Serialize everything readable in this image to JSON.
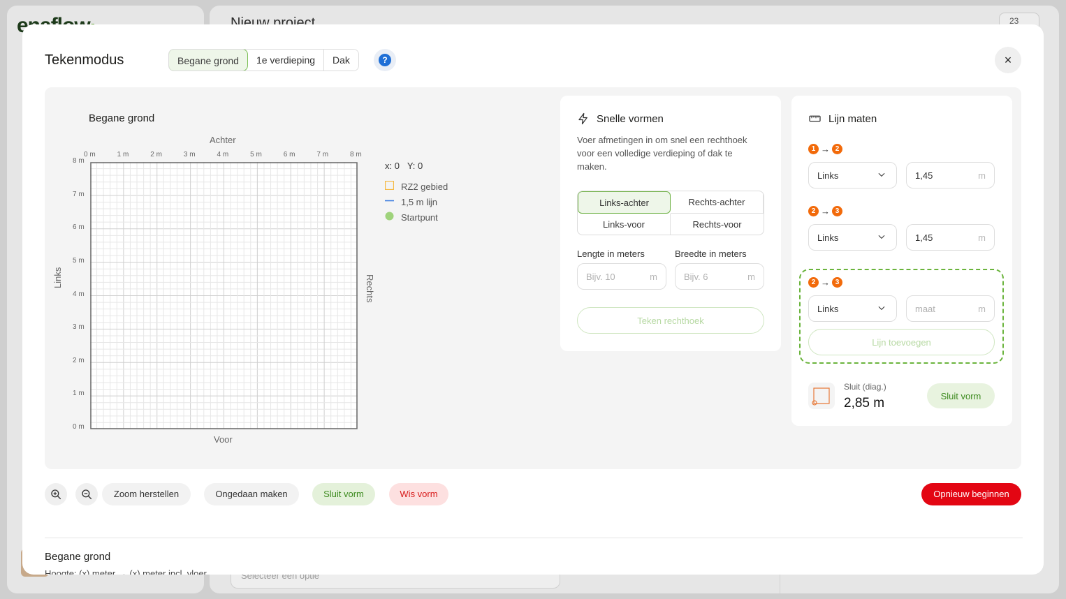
{
  "background": {
    "logo_main": "enaflow",
    "logo_dot": "·",
    "project_title": "Nieuw project",
    "badge_text": "23",
    "select_placeholder": "Selecteer een optie"
  },
  "modal": {
    "title": "Tekenmodus",
    "tabs": [
      {
        "label": "Begane grond",
        "active": true
      },
      {
        "label": "1e verdieping",
        "active": false
      },
      {
        "label": "Dak",
        "active": false
      }
    ],
    "help_label": "?",
    "close_label": "×"
  },
  "canvas": {
    "title": "Begane grond",
    "label_top": "Achter",
    "label_bottom": "Voor",
    "label_left": "Links",
    "label_right": "Rechts",
    "x_ticks": [
      "0 m",
      "1 m",
      "2 m",
      "3 m",
      "4 m",
      "5 m",
      "6 m",
      "7 m",
      "8 m"
    ],
    "y_ticks": [
      "8 m",
      "7 m",
      "6 m",
      "5 m",
      "4 m",
      "3 m",
      "2 m",
      "1 m",
      "0 m"
    ],
    "coords": {
      "x": "x: 0",
      "y": "Y: 0"
    },
    "legend": [
      {
        "label": "RZ2 gebied",
        "type": "square",
        "color": "#f5b942"
      },
      {
        "label": "1,5 m lijn",
        "type": "line",
        "color": "#3a7be0"
      },
      {
        "label": "Startpunt",
        "type": "dot",
        "color": "#9fd37c"
      }
    ]
  },
  "snelle_vormen": {
    "title": "Snelle vormen",
    "description": "Voer afmetingen in om snel een rechthoek voor een volledige verdieping of dak te maken.",
    "options": [
      {
        "label": "Links-achter",
        "selected": true
      },
      {
        "label": "Rechts-achter",
        "selected": false
      },
      {
        "label": "Links-voor",
        "selected": false
      },
      {
        "label": "Rechts-voor",
        "selected": false
      }
    ],
    "length_label": "Lengte in meters",
    "width_label": "Breedte in meters",
    "length_placeholder": "Bijv. 10",
    "width_placeholder": "Bijv. 6",
    "unit": "m",
    "draw_button": "Teken rechthoek"
  },
  "lijn_maten": {
    "title": "Lijn maten",
    "rows": [
      {
        "from": "1",
        "to": "2",
        "direction": "Links",
        "value": "1,45",
        "unit": "m"
      },
      {
        "from": "2",
        "to": "3",
        "direction": "Links",
        "value": "1,45",
        "unit": "m"
      }
    ],
    "new_row": {
      "from": "2",
      "to": "3",
      "direction": "Links",
      "placeholder": "maat",
      "unit": "m",
      "add_button": "Lijn toevoegen"
    },
    "arrow": "→",
    "close_diag_label": "Sluit (diag.)",
    "close_diag_value": "2,85 m",
    "close_button": "Sluit vorm"
  },
  "toolbar": {
    "zoom_reset": "Zoom herstellen",
    "undo": "Ongedaan maken",
    "close_shape": "Sluit vorm",
    "clear_shape": "Wis vorm",
    "restart": "Opnieuw beginnen"
  },
  "section": {
    "title": "Begane grond",
    "subtitle": "Hoogte: (x) meter → (x) meter incl. vloer"
  },
  "colors": {
    "accent_green": "#5aa02c",
    "danger_red": "#e30613",
    "step_orange": "#f26a0a",
    "help_blue": "#1f6fd6"
  }
}
